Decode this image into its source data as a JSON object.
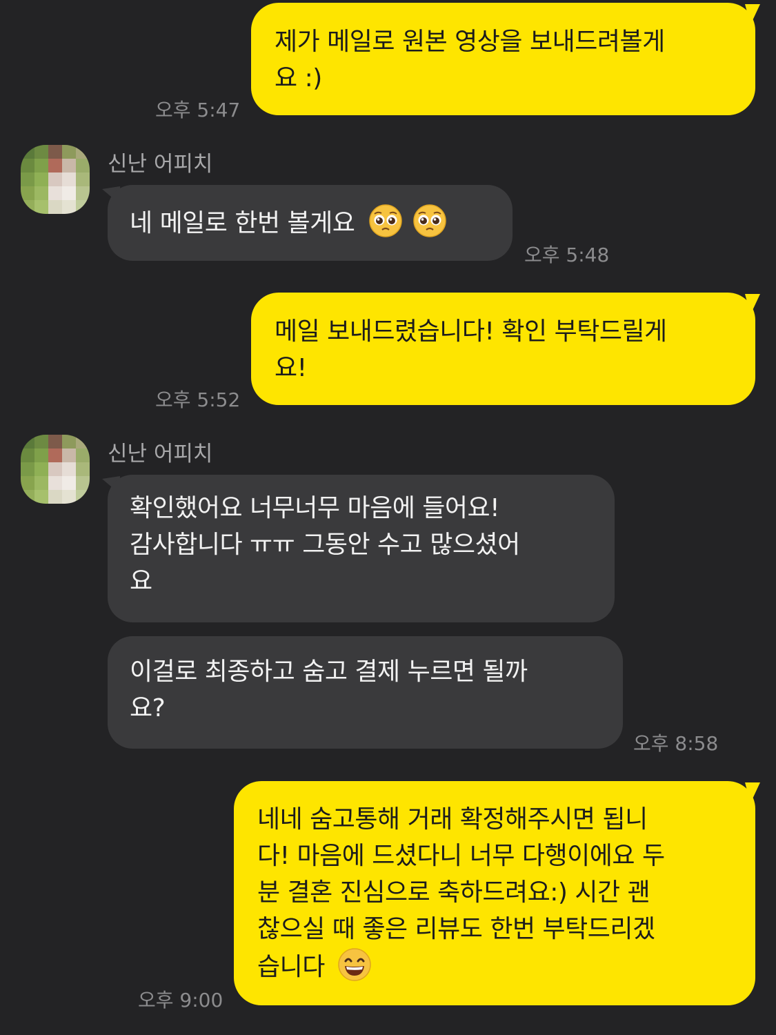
{
  "messages": [
    {
      "id": "m1",
      "side": "sent",
      "text": "제가 메일로 원본 영상을 보내드려볼게\n요 :)",
      "time": "오후 5:47"
    },
    {
      "id": "m2",
      "side": "recv",
      "sender": "신난 어피치",
      "text": "네 메일로 한번 볼게요",
      "emojis": [
        "pleading-face-icon",
        "pleading-face-icon"
      ],
      "time": "오후 5:48"
    },
    {
      "id": "m3",
      "side": "sent",
      "text": "메일 보내드렸습니다! 확인 부탁드릴게\n요!",
      "time": "오후 5:52"
    },
    {
      "id": "m4",
      "side": "recv",
      "sender": "신난 어피치",
      "text": "확인했어요 너무너무 마음에 들어요!\n감사합니다 ㅠㅠ 그동안 수고 많으셨어\n요"
    },
    {
      "id": "m5",
      "side": "recv",
      "text": "이걸로 최종하고 숨고 결제 누르면 될까\n요?",
      "time": "오후 8:58"
    },
    {
      "id": "m6",
      "side": "sent",
      "text": "네네 숨고통해 거래 확정해주시면 됩니\n다! 마음에 드셨다니 너무 다행이에요 두\n분 결혼 진심으로 축하드려요:) 시간 괜\n찮으실 때 좋은 리뷰도 한번 부탁드리겠\n습니다",
      "emojis": [
        "grinning-face-icon"
      ],
      "time": "오후 9:00"
    }
  ],
  "colors": {
    "background": "#232325",
    "sent_bubble": "#fee500",
    "received_bubble": "#3a3a3c",
    "timestamp": "#8c8c8e"
  }
}
